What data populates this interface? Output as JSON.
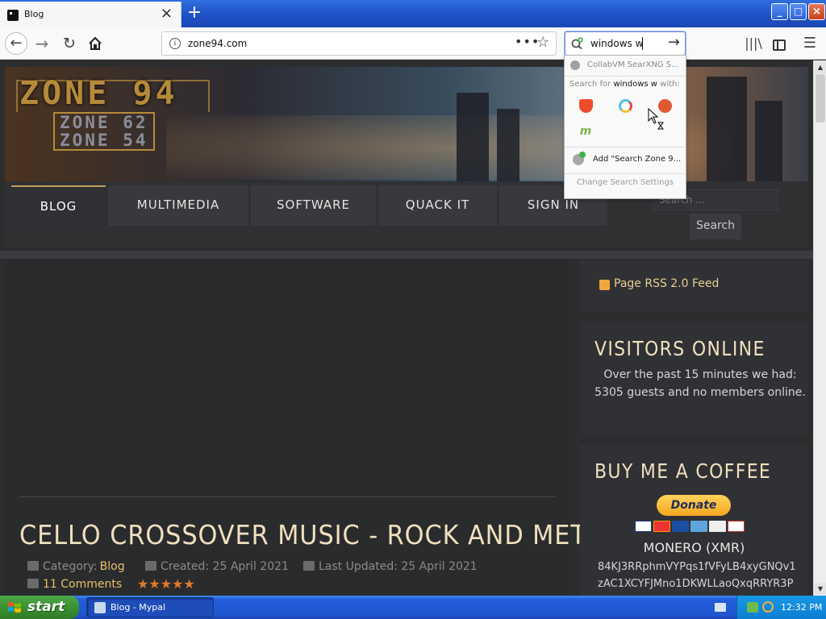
{
  "tab": {
    "title": "Blog",
    "close_glyph": "×",
    "new_tab_glyph": "+"
  },
  "window_controls": {
    "minimize": "_",
    "maximize": "□",
    "close": "×"
  },
  "navbar": {
    "back_glyph": "←",
    "forward_glyph": "→",
    "reload_glyph": "↻",
    "home_glyph": "⌂",
    "url": "zone94.com",
    "page_actions_glyph": "•••",
    "bookmark_glyph": "☆",
    "search_value": "windows w",
    "search_go_glyph": "→",
    "library_glyph": "|||\\",
    "menu_glyph": "☰"
  },
  "search_dropdown": {
    "suggestion": "CollabVM SearXNG S...",
    "search_for_prefix": "Search for ",
    "search_for_query": "windows w",
    "search_for_suffix": " with:",
    "engines": [
      {
        "name": "Brave",
        "icon": "brave-icon"
      },
      {
        "name": "Qwant",
        "icon": "qwant-icon"
      },
      {
        "name": "DuckDuckGo",
        "icon": "duckduckgo-icon"
      },
      {
        "name": "Mojeek",
        "icon": "mojeek-icon",
        "glyph": "m"
      }
    ],
    "add_engine": "Add \"Search Zone 9...",
    "settings": "Change Search Settings"
  },
  "site": {
    "logo_main": "ZONE 94",
    "logo_sub_1": "ZONE 62",
    "logo_sub_2": "ZONE 54",
    "nav": [
      "BLOG",
      "MULTIMEDIA",
      "SOFTWARE",
      "QUACK IT",
      "SIGN IN"
    ],
    "search_placeholder": "Search ...",
    "search_button": "Search"
  },
  "article": {
    "title": "CELLO CROSSOVER MUSIC - ROCK AND METAL",
    "category_label": "Category:",
    "category_value": "Blog",
    "created": "Created: 25 April 2021",
    "updated": "Last Updated: 25 April 2021",
    "comments": "11 Comments",
    "rating_stars": "★★★★★",
    "rating": 5
  },
  "sidebar": {
    "rss": "Page RSS 2.0 Feed",
    "visitors_title": "VISITORS ONLINE",
    "visitors_body": "Over the past 15 minutes we had: 5305 guests and no members online.",
    "coffee_title": "BUY ME A COFFEE",
    "donate": "Donate",
    "monero_title": "MONERO (XMR)",
    "monero_address": "84KJ3RRphmVYPqs1fVFyLB4xyGNQv1zAC1XCYFJMno1DKWLLaoQxqRRYR3P"
  },
  "taskbar": {
    "start": "start",
    "task_title": "Blog - Mypal",
    "clock": "12:32 PM"
  },
  "colors": {
    "accent_gold": "#e6c16a",
    "title_cream": "#efe0bd",
    "xp_blue": "#245edb",
    "start_green": "#3a9131"
  }
}
